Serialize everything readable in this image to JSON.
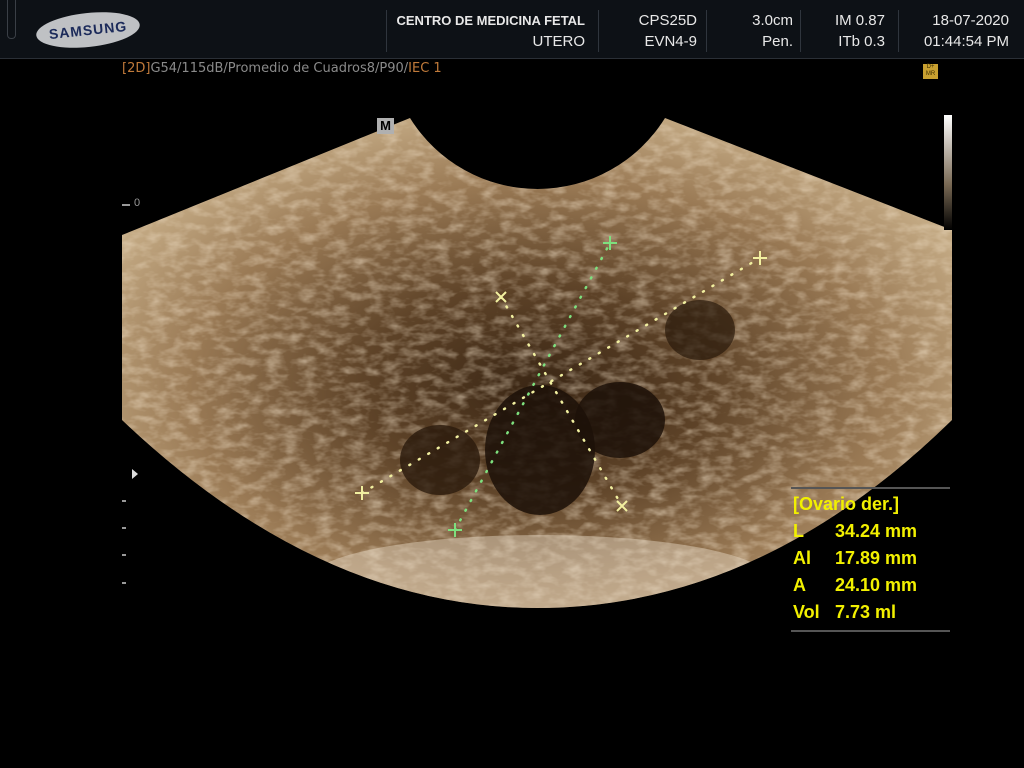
{
  "header": {
    "brand": "SAMSUNG",
    "institution": "CENTRO DE MEDICINA FETAL",
    "exam": "UTERO",
    "probe": "CPS25D",
    "preset": "EVN4-9",
    "depth": "3.0cm",
    "focus": "Pen.",
    "mi": "IM 0.87",
    "tib": "ITb 0.3",
    "date": "18-07-2020",
    "time": "01:44:54 PM"
  },
  "params": {
    "mode": "[2D]",
    "settings": "G54/115dB/Promedio de Cuadros8/P90/",
    "iec": "IEC 1"
  },
  "badge": "D+ MR",
  "orientation_marker": "M",
  "scale_zero": "0",
  "measurements": {
    "title": "[Ovario der.]",
    "rows": [
      {
        "label": "L",
        "value": "34.24 mm"
      },
      {
        "label": "Al",
        "value": "17.89 mm"
      },
      {
        "label": "A",
        "value": "24.10 mm"
      },
      {
        "label": "Vol",
        "value": "7.73 ml"
      }
    ]
  },
  "colors": {
    "caliper_yellow": "#f2f0a0",
    "caliper_green": "#7ee07e",
    "text_yellow": "#f2f000",
    "tissue": "#8a6a45"
  }
}
